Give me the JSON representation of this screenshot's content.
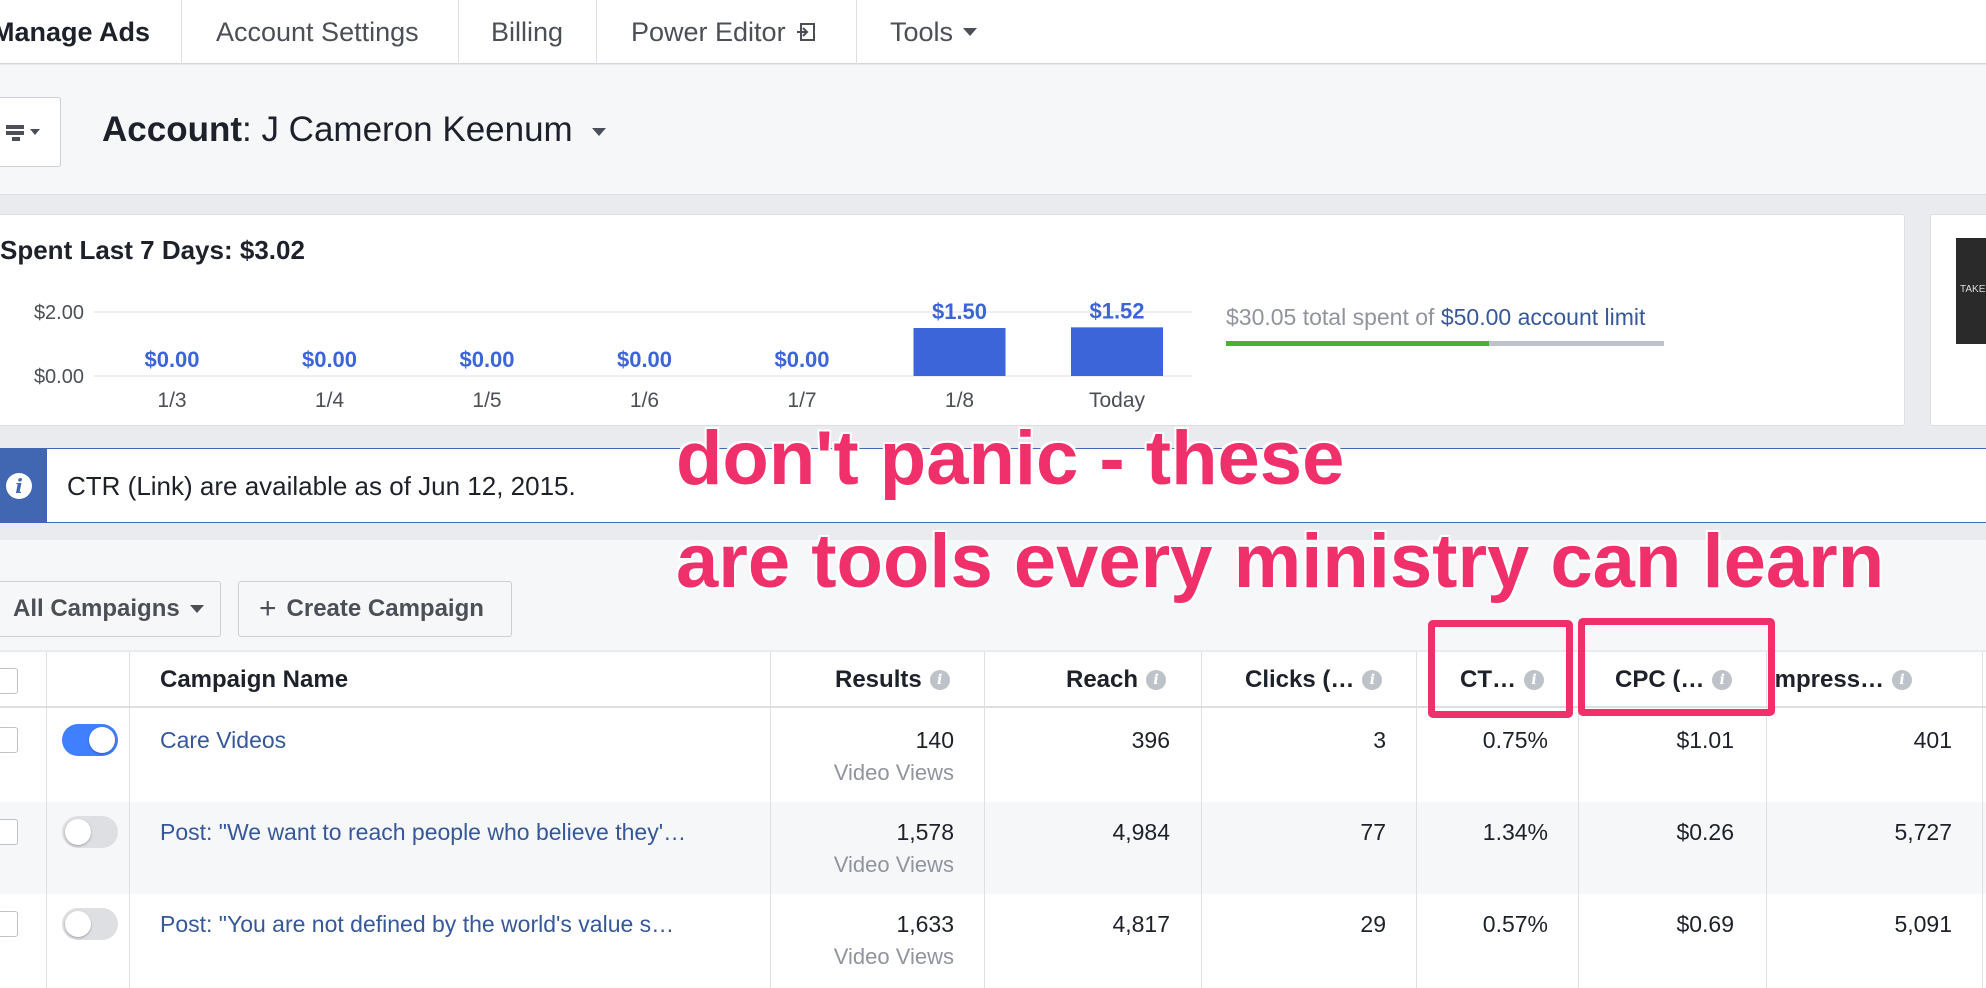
{
  "topnav": {
    "tabs": [
      {
        "label": "Manage Ads",
        "active": true
      },
      {
        "label": "Account Settings"
      },
      {
        "label": "Billing"
      },
      {
        "label": "Power Editor"
      },
      {
        "label": "Tools"
      }
    ]
  },
  "account": {
    "label": "Account",
    "name": ": J Cameron Keenum"
  },
  "spend": {
    "title": "Spent Last 7 Days: $3.02",
    "limit_prefix": "$30.05 total spent of ",
    "limit_value": "$50.00 account limit",
    "limit_fraction": 0.601
  },
  "chart_data": {
    "type": "bar",
    "title": "Spent Last 7 Days: $3.02",
    "categories": [
      "1/3",
      "1/4",
      "1/5",
      "1/6",
      "1/7",
      "1/8",
      "Today"
    ],
    "values": [
      0.0,
      0.0,
      0.0,
      0.0,
      0.0,
      1.5,
      1.52
    ],
    "value_labels": [
      "$0.00",
      "$0.00",
      "$0.00",
      "$0.00",
      "$0.00",
      "$1.50",
      "$1.52"
    ],
    "y_tick_labels": [
      "$2.00",
      "$0.00"
    ],
    "y_ticks": [
      2.0,
      0.0
    ],
    "ylim": [
      0,
      2
    ],
    "bar_color": "#3b65d8"
  },
  "notice": {
    "text": "CTR (Link) are available as of Jun 12, 2015."
  },
  "toolbar": {
    "all_campaigns": "All Campaigns",
    "create_campaign": "Create Campaign"
  },
  "table": {
    "headers": {
      "name": "Campaign Name",
      "results": "Results",
      "reach": "Reach",
      "clicks": "Clicks (…",
      "ctr": "CT…",
      "cpc": "CPC (…",
      "impressions": "Impress…"
    },
    "rows": [
      {
        "on": true,
        "name": "Care Videos",
        "results": "140",
        "results_sub": "Video Views",
        "reach": "396",
        "clicks": "3",
        "ctr": "0.75%",
        "cpc": "$1.01",
        "impressions": "401"
      },
      {
        "on": false,
        "name": "Post: \"We want to reach people who believe they'…",
        "results": "1,578",
        "results_sub": "Video Views",
        "reach": "4,984",
        "clicks": "77",
        "ctr": "1.34%",
        "cpc": "$0.26",
        "impressions": "5,727"
      },
      {
        "on": false,
        "name": "Post: \"You are not defined by the world's value s…",
        "results": "1,633",
        "results_sub": "Video Views",
        "reach": "4,817",
        "clicks": "29",
        "ctr": "0.57%",
        "cpc": "$0.69",
        "impressions": "5,091"
      }
    ]
  },
  "annotation": {
    "line1": "don't panic - these",
    "line2": "are tools every ministry can learn",
    "color": "#f0306b"
  }
}
